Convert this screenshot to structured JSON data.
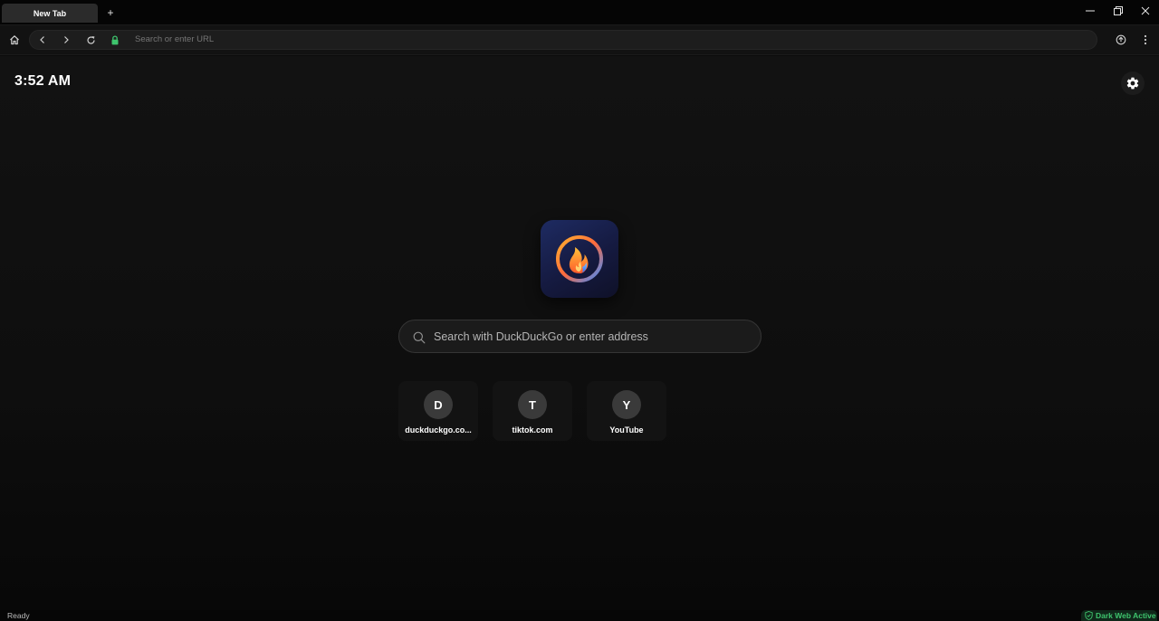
{
  "window": {
    "tab_title": "New Tab",
    "new_tab_symbol": "+",
    "controls": [
      "minimize-icon",
      "restore-icon",
      "close-icon"
    ]
  },
  "toolbar": {
    "url_placeholder": "Search or enter URL",
    "icons": [
      "home-icon",
      "back-icon",
      "forward-icon",
      "reload-icon",
      "lock-icon",
      "download-icon",
      "menu-icon"
    ],
    "lock_color": "#3ec46d"
  },
  "newtab": {
    "clock": "3:52 AM",
    "settings_icon": "gear-icon",
    "logo_icon": "flame-logo-icon",
    "search_placeholder": "Search with DuckDuckGo or enter address",
    "search_icon": "search-icon",
    "shortcuts": [
      {
        "letter": "D",
        "label": "duckduckgo.co..."
      },
      {
        "letter": "T",
        "label": "tiktok.com"
      },
      {
        "letter": "Y",
        "label": "YouTube"
      }
    ]
  },
  "status": {
    "text": "Ready",
    "dark_web_label": "Dark Web Active",
    "dark_web_icon": "shield-check-icon",
    "accent": "#3ec46d"
  }
}
